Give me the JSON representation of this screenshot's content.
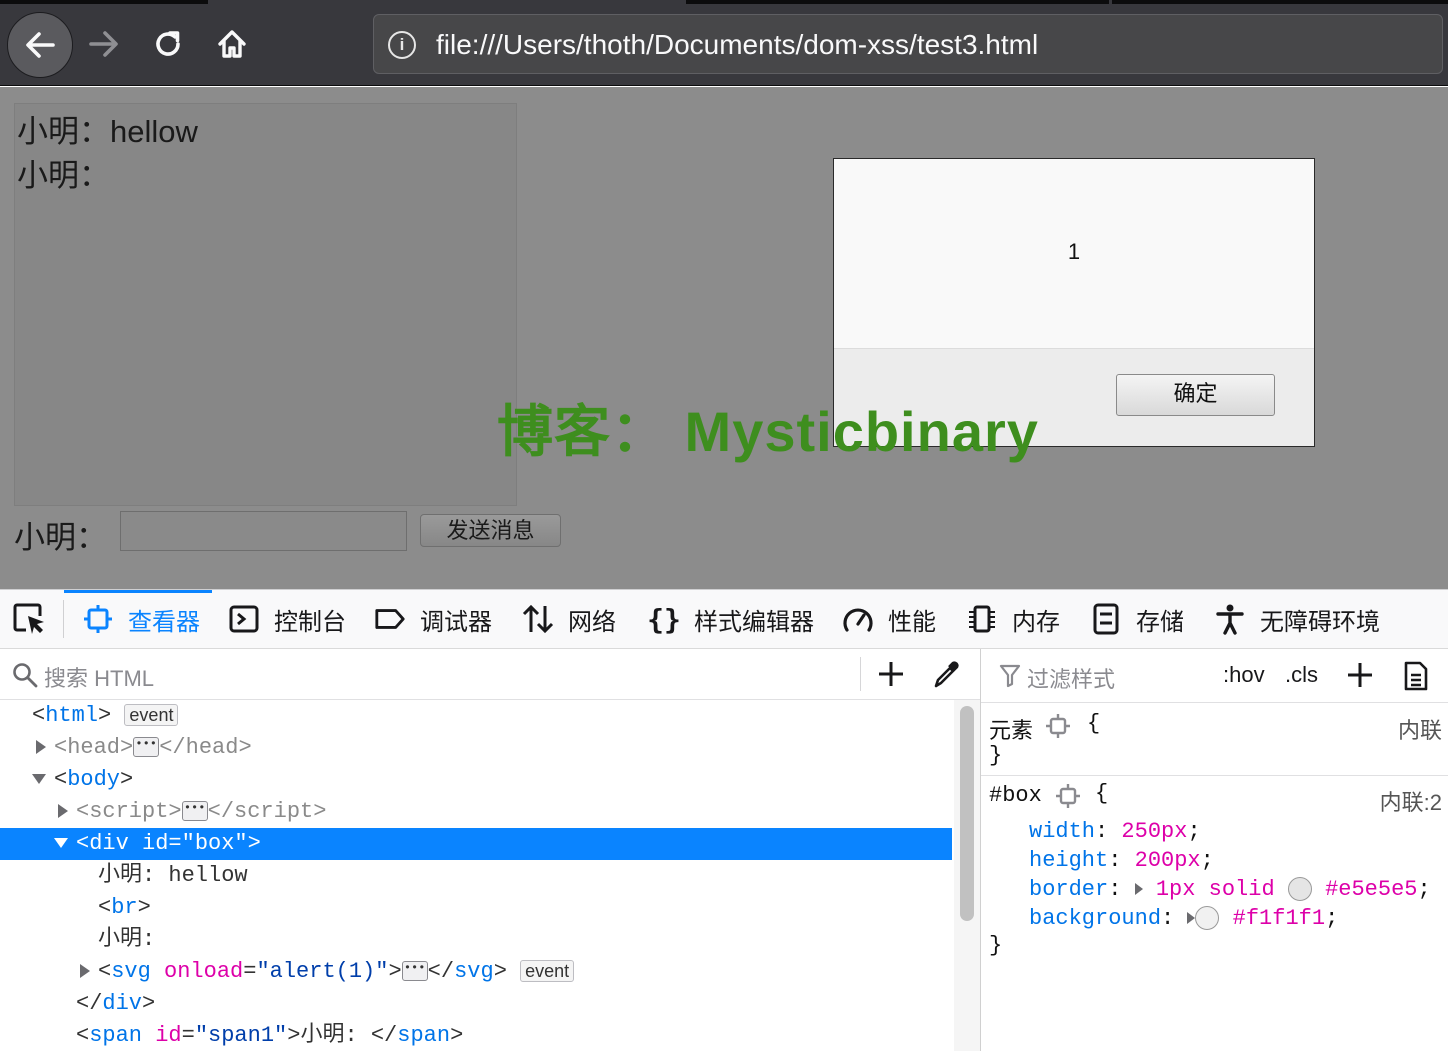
{
  "browser": {
    "url": "file:///Users/thoth/Documents/dom-xss/test3.html",
    "icons": [
      "back-icon",
      "forward-icon",
      "reload-icon",
      "home-icon",
      "info-icon"
    ]
  },
  "page": {
    "messages": [
      "小明：hellow",
      "小明："
    ],
    "input_label": "小明：",
    "send_label": "发送消息",
    "watermark": "博客： Mysticbinary",
    "alert": {
      "message": "1",
      "ok_label": "确定"
    }
  },
  "devtools": {
    "tabs": [
      {
        "label": "查看器",
        "icon": "inspector-icon",
        "active": true
      },
      {
        "label": "控制台",
        "icon": "console-icon"
      },
      {
        "label": "调试器",
        "icon": "debugger-icon"
      },
      {
        "label": "网络",
        "icon": "network-icon"
      },
      {
        "label": "样式编辑器",
        "icon": "style-editor-icon"
      },
      {
        "label": "性能",
        "icon": "performance-icon"
      },
      {
        "label": "内存",
        "icon": "memory-icon"
      },
      {
        "label": "存储",
        "icon": "storage-icon"
      },
      {
        "label": "无障碍环境",
        "icon": "accessibility-icon"
      }
    ],
    "search_placeholder": "搜索 HTML",
    "tree": {
      "html": "html",
      "head": "head",
      "body": "body",
      "script": "script",
      "div": "div",
      "div_attr": "id",
      "div_val": "\"box\"",
      "text1": "小明: hellow",
      "br": "br",
      "text2": "小明:",
      "svg": "svg",
      "svg_attr": "onload",
      "svg_val": "\"alert(1)\"",
      "span": "span",
      "span_attr": "id",
      "span_val": "\"span1\"",
      "span_text": "小明: ",
      "event_badge": "event"
    },
    "styles": {
      "filter_placeholder": "过滤样式",
      "hov": ":hov",
      "cls": ".cls",
      "element_rule": "元素",
      "element_origin": "内联",
      "box_selector": "#box",
      "box_origin": "内联:2",
      "declarations": [
        {
          "prop": "width",
          "value": "250px"
        },
        {
          "prop": "height",
          "value": "200px"
        },
        {
          "prop": "border",
          "value": "1px solid",
          "color": "#e5e5e5"
        },
        {
          "prop": "background",
          "value": "",
          "color": "#f1f1f1"
        }
      ]
    }
  }
}
